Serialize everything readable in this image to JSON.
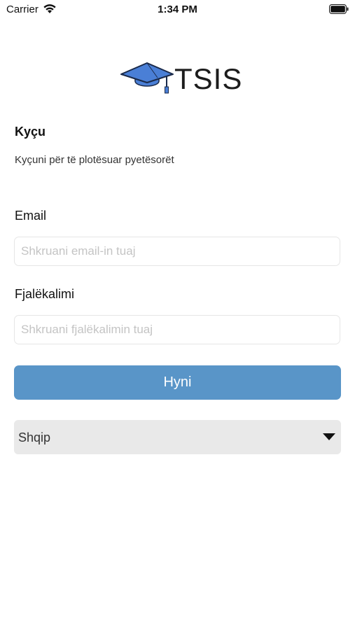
{
  "status_bar": {
    "carrier": "Carrier",
    "time": "1:34 PM"
  },
  "logo": {
    "text": "TSIS",
    "icon": "graduation-cap-icon",
    "icon_color": "#4a7fd6"
  },
  "login": {
    "title": "Kyçu",
    "subtitle": "Kyçuni për të plotësuar pyetësorët",
    "email_label": "Email",
    "email_value": "",
    "email_placeholder": "Shkruani email-in tuaj",
    "password_label": "Fjalëkalimi",
    "password_value": "",
    "password_placeholder": "Shkruani fjalëkalimin tuaj",
    "submit_label": "Hyni",
    "submit_color": "#5995c8"
  },
  "language": {
    "selected": "Shqip"
  }
}
